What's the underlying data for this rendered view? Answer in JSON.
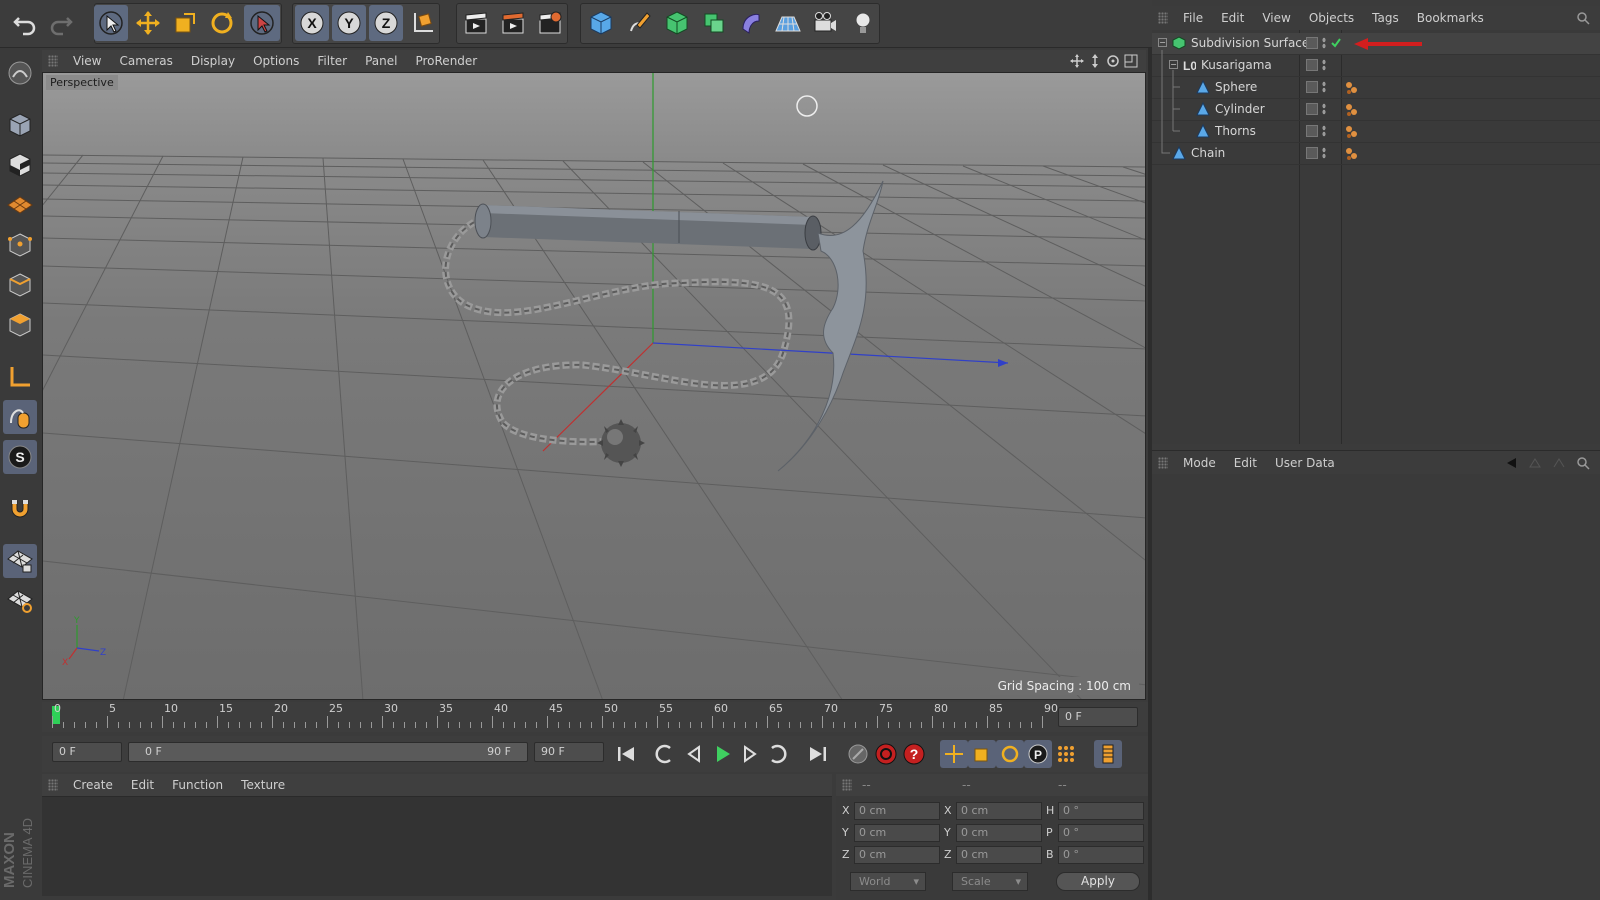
{
  "viewport": {
    "menu": [
      "View",
      "Cameras",
      "Display",
      "Options",
      "Filter",
      "Panel",
      "ProRender"
    ],
    "label": "Perspective",
    "grid_spacing": "Grid Spacing : 100 cm",
    "axis_labels": {
      "y": "Y",
      "x": "X",
      "z": "Z"
    }
  },
  "toolbar": {
    "axis_x": "X",
    "axis_y": "Y",
    "axis_z": "Z"
  },
  "timeline": {
    "ticks": [
      "0",
      "5",
      "10",
      "15",
      "20",
      "25",
      "30",
      "35",
      "40",
      "45",
      "50",
      "55",
      "60",
      "65",
      "70",
      "75",
      "80",
      "85",
      "90"
    ],
    "current_frame": "0 F",
    "start_field": "0 F",
    "range_start": "0 F",
    "range_end": "90 F",
    "end_field": "90 F"
  },
  "material_manager": {
    "menu": [
      "Create",
      "Edit",
      "Function",
      "Texture"
    ]
  },
  "coordinates": {
    "header": [
      "--",
      "--",
      "--"
    ],
    "rows": [
      {
        "l1": "X",
        "v1": "0 cm",
        "l2": "X",
        "v2": "0 cm",
        "l3": "H",
        "v3": "0 °"
      },
      {
        "l1": "Y",
        "v1": "0 cm",
        "l2": "Y",
        "v2": "0 cm",
        "l3": "P",
        "v3": "0 °"
      },
      {
        "l1": "Z",
        "v1": "0 cm",
        "l2": "Z",
        "v2": "0 cm",
        "l3": "B",
        "v3": "0 °"
      }
    ],
    "space": "World",
    "mode": "Scale",
    "apply": "Apply"
  },
  "object_manager": {
    "menu": [
      "File",
      "Edit",
      "View",
      "Objects",
      "Tags",
      "Bookmarks"
    ],
    "objects": [
      {
        "name": "Subdivision Surface"
      },
      {
        "name": "Kusarigama"
      },
      {
        "name": "Sphere"
      },
      {
        "name": "Cylinder"
      },
      {
        "name": "Thorns"
      },
      {
        "name": "Chain"
      }
    ]
  },
  "attribute_manager": {
    "menu": [
      "Mode",
      "Edit",
      "User Data"
    ]
  },
  "brand": {
    "line1": "MAXON",
    "line2": "CINEMA 4D"
  },
  "colors": {
    "accent_red": "#d21e1e",
    "selection_blue": "#5e6a80",
    "axis_green": "#2e9b2e",
    "axis_red": "#c03030",
    "axis_blue": "#3040c8"
  }
}
